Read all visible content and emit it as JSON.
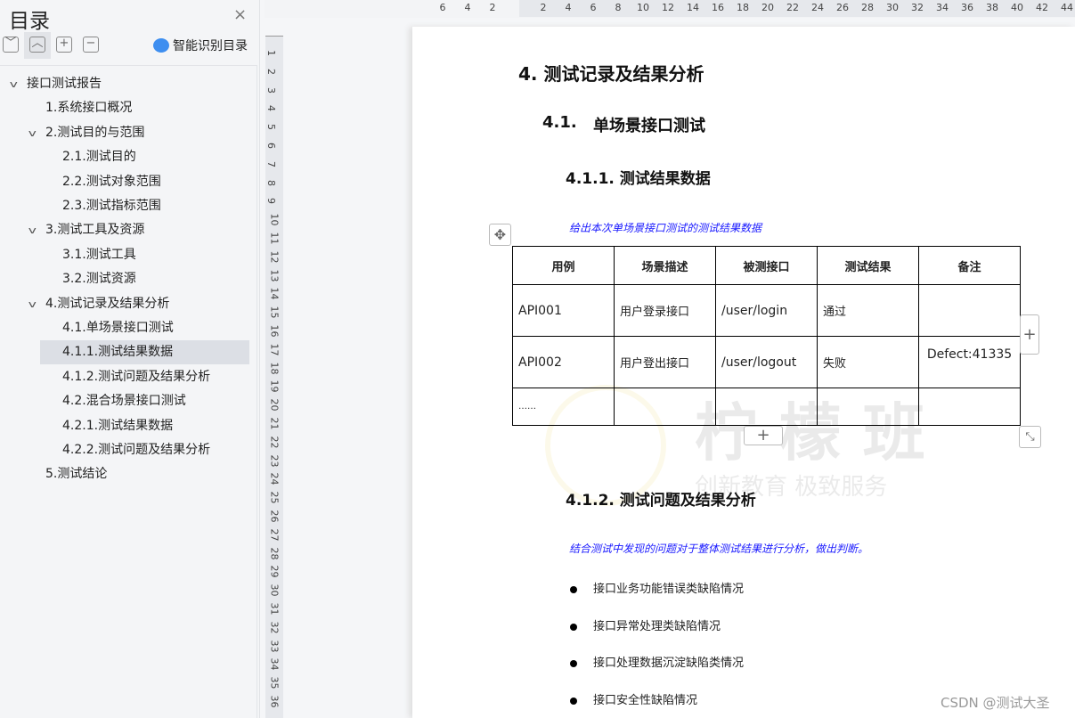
{
  "sidebar": {
    "title": "目录",
    "close": "×",
    "toolbar": [
      "﹀",
      "︿",
      "+",
      "−"
    ],
    "smart_label": "智能识别目录",
    "items": [
      {
        "label": "接口测试报告",
        "level": 1,
        "chev": true
      },
      {
        "label": "1.系统接口概况",
        "level": 2,
        "chev": false
      },
      {
        "label": "2.测试目的与范围",
        "level": 2,
        "chev": true
      },
      {
        "label": "2.1.测试目的",
        "level": 3
      },
      {
        "label": "2.2.测试对象范围",
        "level": 3
      },
      {
        "label": "2.3.测试指标范围",
        "level": 3
      },
      {
        "label": "3.测试工具及资源",
        "level": 2,
        "chev": true
      },
      {
        "label": "3.1.测试工具",
        "level": 3
      },
      {
        "label": "3.2.测试资源",
        "level": 3
      },
      {
        "label": "4.测试记录及结果分析",
        "level": 2,
        "chev": true
      },
      {
        "label": "4.1.单场景接口测试",
        "level": 3
      },
      {
        "label": "4.1.1.测试结果数据",
        "level": 3,
        "selected": true
      },
      {
        "label": "4.1.2.测试问题及结果分析",
        "level": 3
      },
      {
        "label": "4.2.混合场景接口测试",
        "level": 3
      },
      {
        "label": "4.2.1.测试结果数据",
        "level": 3
      },
      {
        "label": "4.2.2.测试问题及结果分析",
        "level": 3
      },
      {
        "label": "5.测试结论",
        "level": 2,
        "chev": false
      }
    ]
  },
  "ruler": {
    "left": [
      "6",
      "4",
      "2"
    ],
    "right": [
      "2",
      "4",
      "6",
      "8",
      "10",
      "12",
      "14",
      "16",
      "18",
      "20",
      "22",
      "24",
      "26",
      "28",
      "30",
      "32",
      "34",
      "36",
      "38",
      "40",
      "42",
      "44"
    ],
    "vertical_count": 36
  },
  "doc": {
    "h1": "4. 测试记录及结果分析",
    "h2_num": "4.1.",
    "h2": "单场景接口测试",
    "h3a": "4.1.1. 测试结果数据",
    "note1": "给出本次单场景接口测试的测试结果数据",
    "table": {
      "headers": [
        "用例",
        "场景描述",
        "被测接口",
        "测试结果",
        "备注"
      ],
      "rows": [
        [
          "API001",
          "用户登录接口",
          "/user/login",
          "通过",
          ""
        ],
        [
          "API002",
          "用户登出接口",
          "/user/logout",
          "失败",
          "Defect:41335"
        ],
        [
          "……",
          "",
          "",
          "",
          ""
        ]
      ]
    },
    "h3b": "4.1.2. 测试问题及结果分析",
    "note2": "结合测试中发现的问题对于整体测试结果进行分析，做出判断。",
    "bullets": [
      "接口业务功能错误类缺陷情况",
      "接口异常处理类缺陷情况",
      "接口处理数据沉淀缺陷类情况",
      "接口安全性缺陷情况"
    ]
  },
  "watermark": {
    "logo": "柠檬班",
    "slogan": "创新教育  极致服务",
    "credit": "CSDN @测试大圣"
  }
}
